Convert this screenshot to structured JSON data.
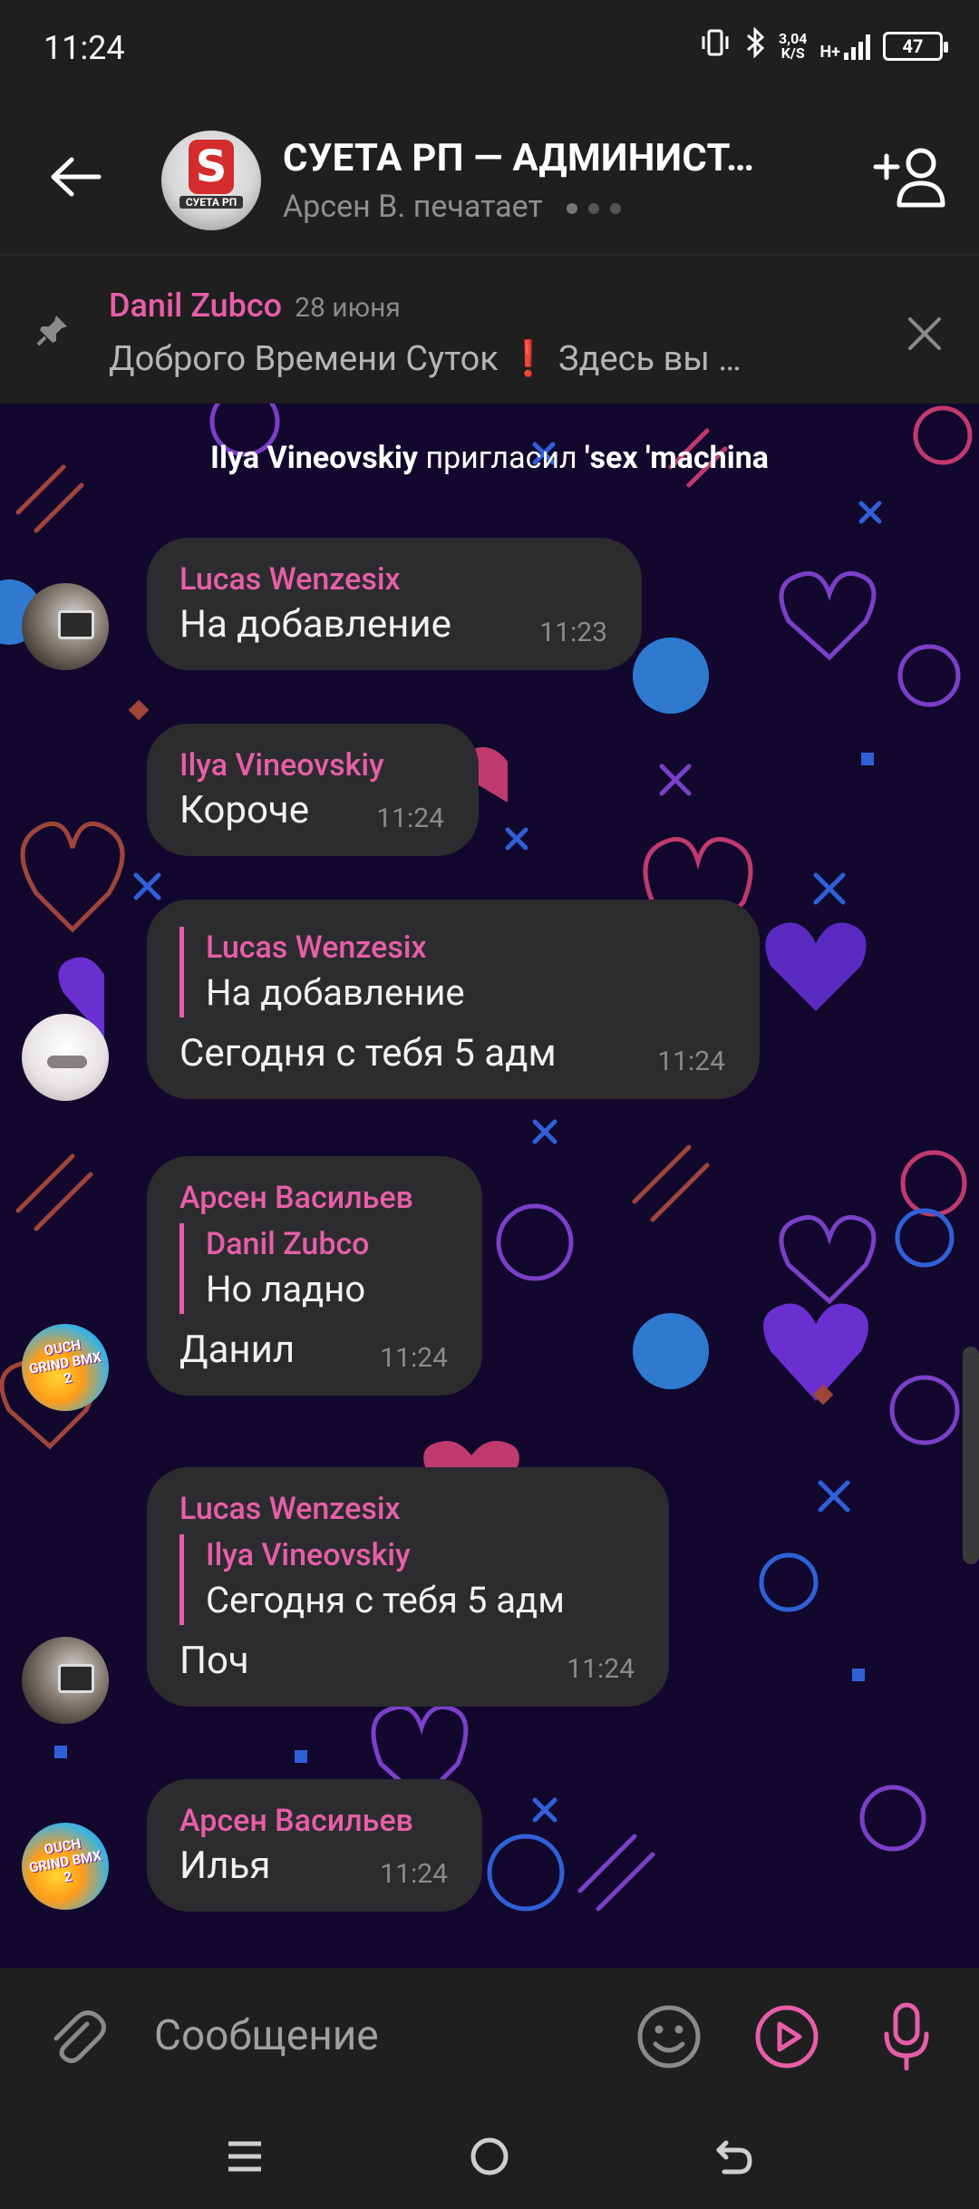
{
  "status_bar": {
    "time": "11:24",
    "net_speed_value": "3,04",
    "net_speed_unit": "K/S",
    "network_type": "H+",
    "battery": "47"
  },
  "header": {
    "title": "СУЕТА РП — АДМИНИСТ…",
    "status": "Арсен В. печатает",
    "avatar_letter": "S",
    "avatar_caption": "СУЕТА РП"
  },
  "pinned": {
    "author": "Danil Zubco",
    "date": "28 июня",
    "text": "Доброго Времени Суток ❗  Здесь вы …"
  },
  "system_message": {
    "actor": "Ilya Vineovskiy",
    "action": "пригласил",
    "target": "'sex 'machina"
  },
  "messages": [
    {
      "author": "Lucas Wenzesix",
      "text": "На добавление",
      "time": "11:23"
    },
    {
      "author": "Ilya Vineovskiy",
      "text": "Короче",
      "time": "11:24"
    },
    {
      "reply_author": "Lucas Wenzesix",
      "reply_text": "На добавление",
      "text": "Сегодня с тебя 5 адм",
      "time": "11:24"
    },
    {
      "author": "Арсен Васильев",
      "reply_author": "Danil Zubco",
      "reply_text": "Но ладно",
      "text": "Данил",
      "time": "11:24"
    },
    {
      "author": "Lucas Wenzesix",
      "reply_author": "Ilya Vineovskiy",
      "reply_text": "Сегодня с тебя 5 адм",
      "text": "Поч",
      "time": "11:24"
    },
    {
      "author": "Арсен Васильев",
      "text": "Илья",
      "time": "11:24"
    }
  ],
  "avatars": {
    "bmx_label": "OUCH GRIND BMX 2"
  },
  "input": {
    "placeholder": "Сообщение"
  },
  "colors": {
    "accent": "#e75ea8",
    "bubble": "#2c2c2e",
    "chat_bg": "#12082e",
    "bar_bg": "#1f1f1f"
  },
  "icons": {
    "back": "arrow-left-icon",
    "add_member": "person-add-icon",
    "pin": "pin-icon",
    "close": "close-icon",
    "attach": "paperclip-icon",
    "emoji": "smiley-icon",
    "video": "play-circle-icon",
    "mic": "microphone-icon"
  }
}
